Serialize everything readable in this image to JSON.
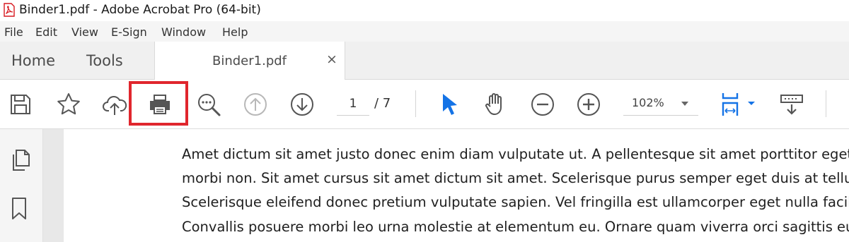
{
  "window": {
    "title": "Binder1.pdf - Adobe Acrobat Pro (64-bit)"
  },
  "menu": [
    "File",
    "Edit",
    "View",
    "E-Sign",
    "Window",
    "Help"
  ],
  "tabs": {
    "home": "Home",
    "tools": "Tools",
    "document": "Binder1.pdf",
    "close": "×"
  },
  "toolbar": {
    "page_current": "1",
    "page_total": "/ 7",
    "zoom": "102%",
    "highlighted_tool": "print",
    "accent_color": "#1473e6",
    "highlight_color": "#e0262d"
  },
  "document": {
    "lines": [
      "Amet dictum sit amet justo donec enim diam vulputate ut. A pellentesque sit amet porttitor eget dolor",
      "morbi non. Sit amet cursus sit amet dictum sit amet. Scelerisque purus semper eget duis at tellus at",
      "Scelerisque eleifend donec pretium vulputate sapien. Vel fringilla est ullamcorper eget nulla facilisi",
      "Convallis posuere morbi leo urna molestie at elementum eu. Ornare quam viverra orci sagittis eu"
    ]
  }
}
